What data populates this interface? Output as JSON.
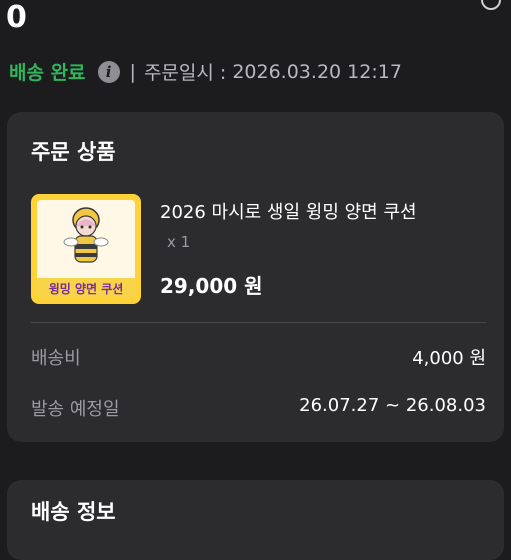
{
  "header": {
    "order_number": "0",
    "status": "배송 완료",
    "info_icon": "i",
    "separator": "|",
    "order_date_label": "주문일시 :",
    "order_date_value": "2026.03.20 12:17"
  },
  "product_section": {
    "title": "주문 상품",
    "thumbnail_text": "윙밍 양면 쿠션",
    "product_name": "2026 마시로 생일 윙밍 양면 쿠션",
    "quantity": "x 1",
    "price": "29,000 원",
    "shipping_fee_label": "배송비",
    "shipping_fee_value": "4,000 원",
    "ship_date_label": "발송 예정일",
    "ship_date_value": "26.07.27 ~ 26.08.03"
  },
  "shipping_section": {
    "title": "배송 정보"
  },
  "colors": {
    "background": "#1c1c1e",
    "card": "#2c2c2e",
    "status_green": "#32b45c",
    "muted_text": "#9a9aa0"
  }
}
